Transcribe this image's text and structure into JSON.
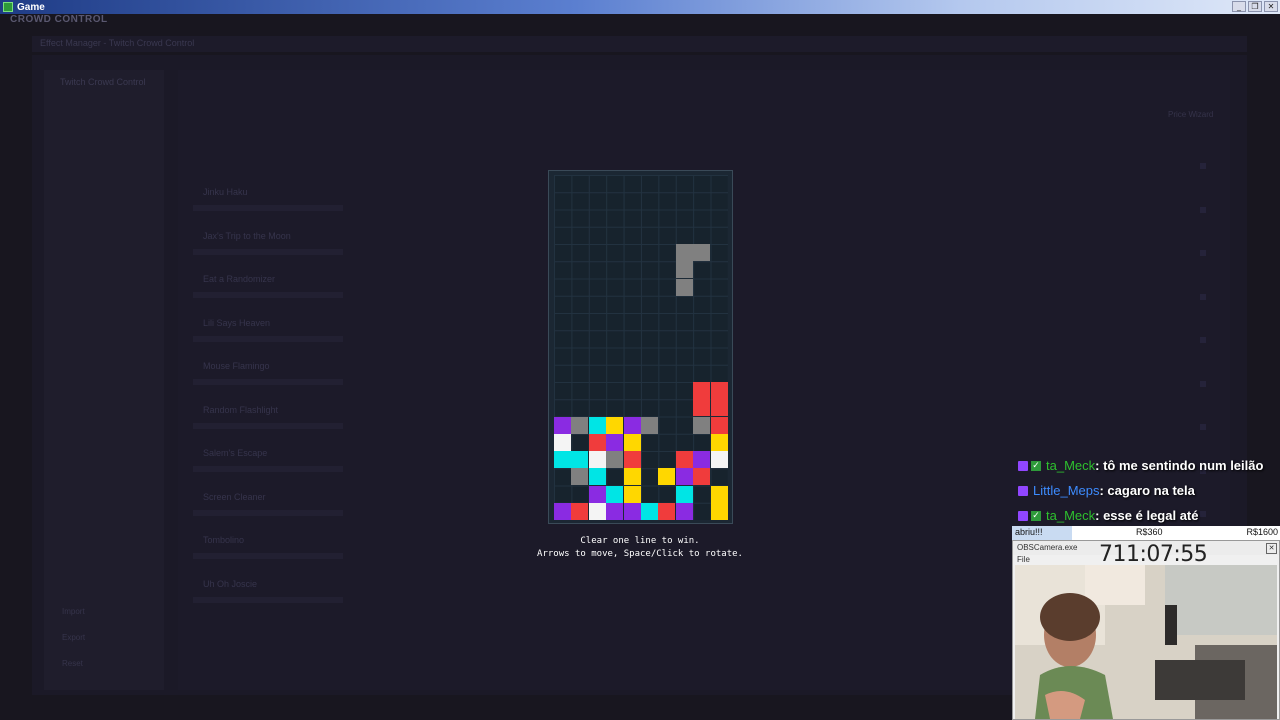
{
  "window": {
    "title": "Game",
    "controls": [
      "_",
      "❐",
      "✕"
    ]
  },
  "background_app": {
    "brand": "CROWD CONTROL",
    "header_title": "Effect Manager - Twitch Crowd Control",
    "sidebar_title": "Twitch Crowd Control",
    "sidebar_items": [
      "Import",
      "Export",
      "Reset"
    ],
    "toolbar_right": "Price Wizard",
    "effects": [
      "Jinku Haku",
      "Jax's Trip to the Moon",
      "Eat a Randomizer",
      "Lili Says Heaven",
      "Mouse Flamingo",
      "Random Flashlight",
      "Salem's Escape",
      "Screen Cleaner",
      "Tombolino",
      "Uh Oh Joscie"
    ]
  },
  "game": {
    "grid_cols": 10,
    "grid_rows": 20,
    "colors": {
      "P": "#8a2be2",
      "G": "#808080",
      "C": "#00e5e5",
      "Y": "#ffd700",
      "R": "#f03c3c",
      "W": "#f4f4f4"
    },
    "falling_piece": [
      [
        7,
        4,
        "G"
      ],
      [
        8,
        4,
        "G"
      ],
      [
        7,
        5,
        "G"
      ],
      [
        7,
        6,
        "G"
      ]
    ],
    "stack": [
      [
        8,
        12,
        "R"
      ],
      [
        9,
        12,
        "R"
      ],
      [
        8,
        13,
        "R"
      ],
      [
        9,
        13,
        "R"
      ],
      [
        0,
        14,
        "P"
      ],
      [
        1,
        14,
        "G"
      ],
      [
        2,
        14,
        "C"
      ],
      [
        3,
        14,
        "Y"
      ],
      [
        4,
        14,
        "P"
      ],
      [
        5,
        14,
        "G"
      ],
      [
        8,
        14,
        "G"
      ],
      [
        9,
        14,
        "R"
      ],
      [
        0,
        15,
        "W"
      ],
      [
        2,
        15,
        "R"
      ],
      [
        3,
        15,
        "P"
      ],
      [
        4,
        15,
        "Y"
      ],
      [
        9,
        15,
        "Y"
      ],
      [
        0,
        16,
        "C"
      ],
      [
        1,
        16,
        "C"
      ],
      [
        2,
        16,
        "W"
      ],
      [
        3,
        16,
        "G"
      ],
      [
        4,
        16,
        "R"
      ],
      [
        7,
        16,
        "R"
      ],
      [
        8,
        16,
        "P"
      ],
      [
        9,
        16,
        "W"
      ],
      [
        1,
        17,
        "G"
      ],
      [
        2,
        17,
        "C"
      ],
      [
        4,
        17,
        "Y"
      ],
      [
        6,
        17,
        "Y"
      ],
      [
        7,
        17,
        "P"
      ],
      [
        8,
        17,
        "R"
      ],
      [
        2,
        18,
        "P"
      ],
      [
        3,
        18,
        "C"
      ],
      [
        4,
        18,
        "Y"
      ],
      [
        7,
        18,
        "C"
      ],
      [
        9,
        18,
        "Y"
      ],
      [
        0,
        19,
        "P"
      ],
      [
        1,
        19,
        "R"
      ],
      [
        2,
        19,
        "W"
      ],
      [
        3,
        19,
        "P"
      ],
      [
        4,
        19,
        "P"
      ],
      [
        5,
        19,
        "C"
      ],
      [
        6,
        19,
        "R"
      ],
      [
        7,
        19,
        "P"
      ],
      [
        9,
        19,
        "Y"
      ]
    ],
    "instructions": [
      "Clear one line to win.",
      "Arrows to move, Space/Click to rotate."
    ]
  },
  "chat": [
    {
      "user": "ta_Meck",
      "color": "#2ec02e",
      "badges": [
        "twitch",
        "check"
      ],
      "message": ": tô me sentindo num leilão"
    },
    {
      "user": "Little_Meps",
      "color": "#3d8cff",
      "badges": [
        "twitch"
      ],
      "message": ": cagaro na tela"
    },
    {
      "user": "ta_Meck",
      "color": "#2ec02e",
      "badges": [
        "twitch",
        "check"
      ],
      "message": ": esse é legal até"
    }
  ],
  "auction": {
    "label": "abriu!!!",
    "mid": "R$360",
    "right": "R$1600"
  },
  "camera": {
    "title": "OBSCamera.exe",
    "menu": "File",
    "timer": "711:07:55"
  }
}
